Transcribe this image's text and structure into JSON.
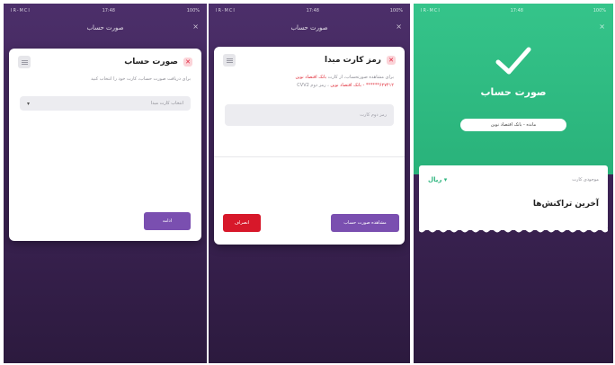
{
  "status": {
    "carrier": "IR-MCI",
    "time": "17:48",
    "battery": "100%"
  },
  "screen1": {
    "header_title": "صورت حساب",
    "close_glyph": "×",
    "card_title": "صورت حساب",
    "card_desc": "برای دریافت صورت حساب، کارت خود را انتخاب کنید",
    "select_placeholder": "انتخاب کارت مبدا",
    "button_label": "ادامه"
  },
  "screen2": {
    "header_title": "صورت حساب",
    "close_glyph": "×",
    "card_title": "رمز کارت مبدا",
    "desc_line1": "برای مشاهده صورتحساب، از کارت",
    "desc_line1_red": "بانک اقتصاد نوین",
    "desc_line2_red": "۶۲۷۴۱۲****** - بانک اقتصاد نوین",
    "desc_line2": "، رمز دوم CVV2",
    "input_placeholder": "رمز دوم کارت",
    "primary_button": "مشاهده صورت حساب",
    "cancel_button": "انصراف"
  },
  "screen3": {
    "close_glyph": "×",
    "title": "صورت حساب",
    "pill_text": "مانده - بانک اقتصاد نوین",
    "balance_label": "موجودی کارت",
    "currency": "ریال",
    "section_title": "آخرین تراکنش‌ها"
  },
  "colors": {
    "purple_bg": "#3e2457",
    "accent_purple": "#7a4fb0",
    "danger_red": "#d7182a",
    "success_green": "#2fbc84"
  }
}
